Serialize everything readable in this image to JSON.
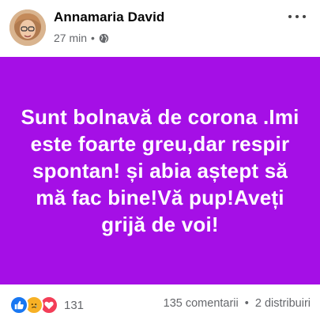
{
  "post": {
    "author": "Annamaria David",
    "time": "27 min",
    "separator": "•",
    "privacy_icon": "globe-icon",
    "more_icon": "more-options-icon",
    "background_color": "#a50fe6",
    "text_color": "#ffffff",
    "text": "Sunt bolnavă de corona .Imi este foarte greu,dar respir spontan! și abia aștept să mă fac bine!Vă pup!Aveți grijă de voi!"
  },
  "footer": {
    "reactions": [
      {
        "type": "like",
        "icon": "like-reaction-icon",
        "color": "#1877f2"
      },
      {
        "type": "sad",
        "icon": "sad-reaction-icon",
        "color": "#f7b125"
      },
      {
        "type": "love",
        "icon": "love-reaction-icon",
        "color": "#f33e58"
      }
    ],
    "reaction_count": "131",
    "comments": "135 comentarii",
    "separator": "•",
    "shares": "2 distribuiri"
  }
}
